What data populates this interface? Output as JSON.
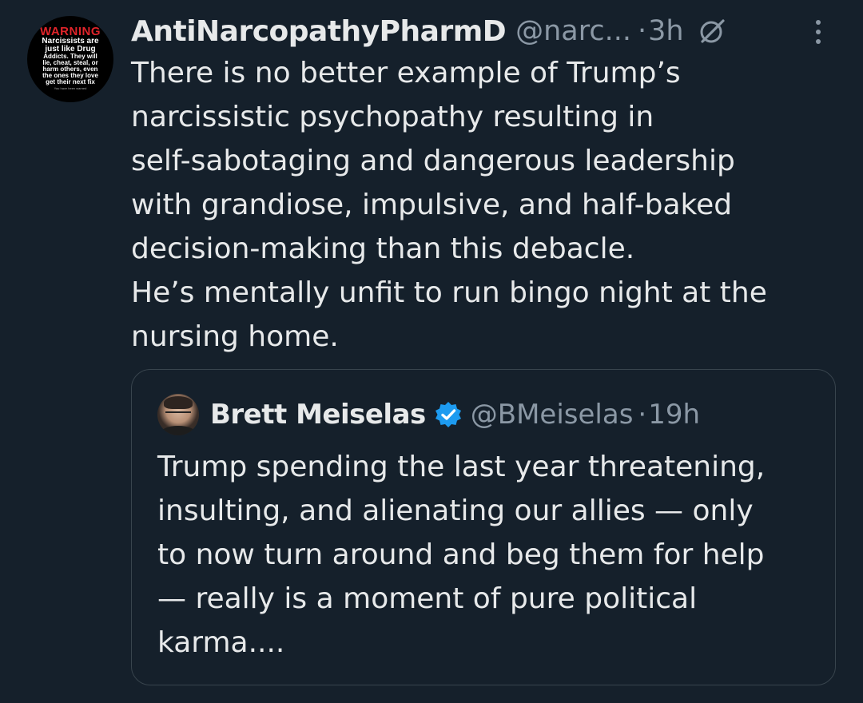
{
  "tweet": {
    "avatar": {
      "lines": [
        "WARNING",
        "Narcissists are",
        "just like Drug",
        "Addicts. They will",
        "lie, cheat, steal, or",
        "harm others, even",
        "the ones they love",
        "get their next fix",
        "You have been warned"
      ]
    },
    "author_name": "AntiNarcopathyPharmD",
    "handle": "@narc...",
    "separator": "·",
    "time": "3h",
    "icons": [
      "grok-icon",
      "more-icon"
    ],
    "text_lines": [
      "There is no better example of Trump’s",
      "narcissistic psychopathy resulting in",
      "self-sabotaging and dangerous leadership",
      "with grandiose, impulsive, and half-baked",
      "decision-making than this debacle.",
      "He’s mentally unfit to run bingo night at the",
      "nursing home."
    ]
  },
  "quoted": {
    "author_name": "Brett Meiselas",
    "verified": true,
    "handle": "@BMeiselas",
    "separator": "·",
    "time": "19h",
    "text_lines": [
      "Trump spending the last year threatening,",
      "insulting, and alienating our allies — only",
      "to now turn around and beg them for help",
      "— really is a moment of pure political",
      "karma...."
    ]
  },
  "colors": {
    "background": "#15202b",
    "text": "#e7e9ea",
    "secondary": "#8b98a5",
    "border": "#38444d",
    "verified": "#1d9bf0",
    "warning_red": "#e0242a"
  }
}
